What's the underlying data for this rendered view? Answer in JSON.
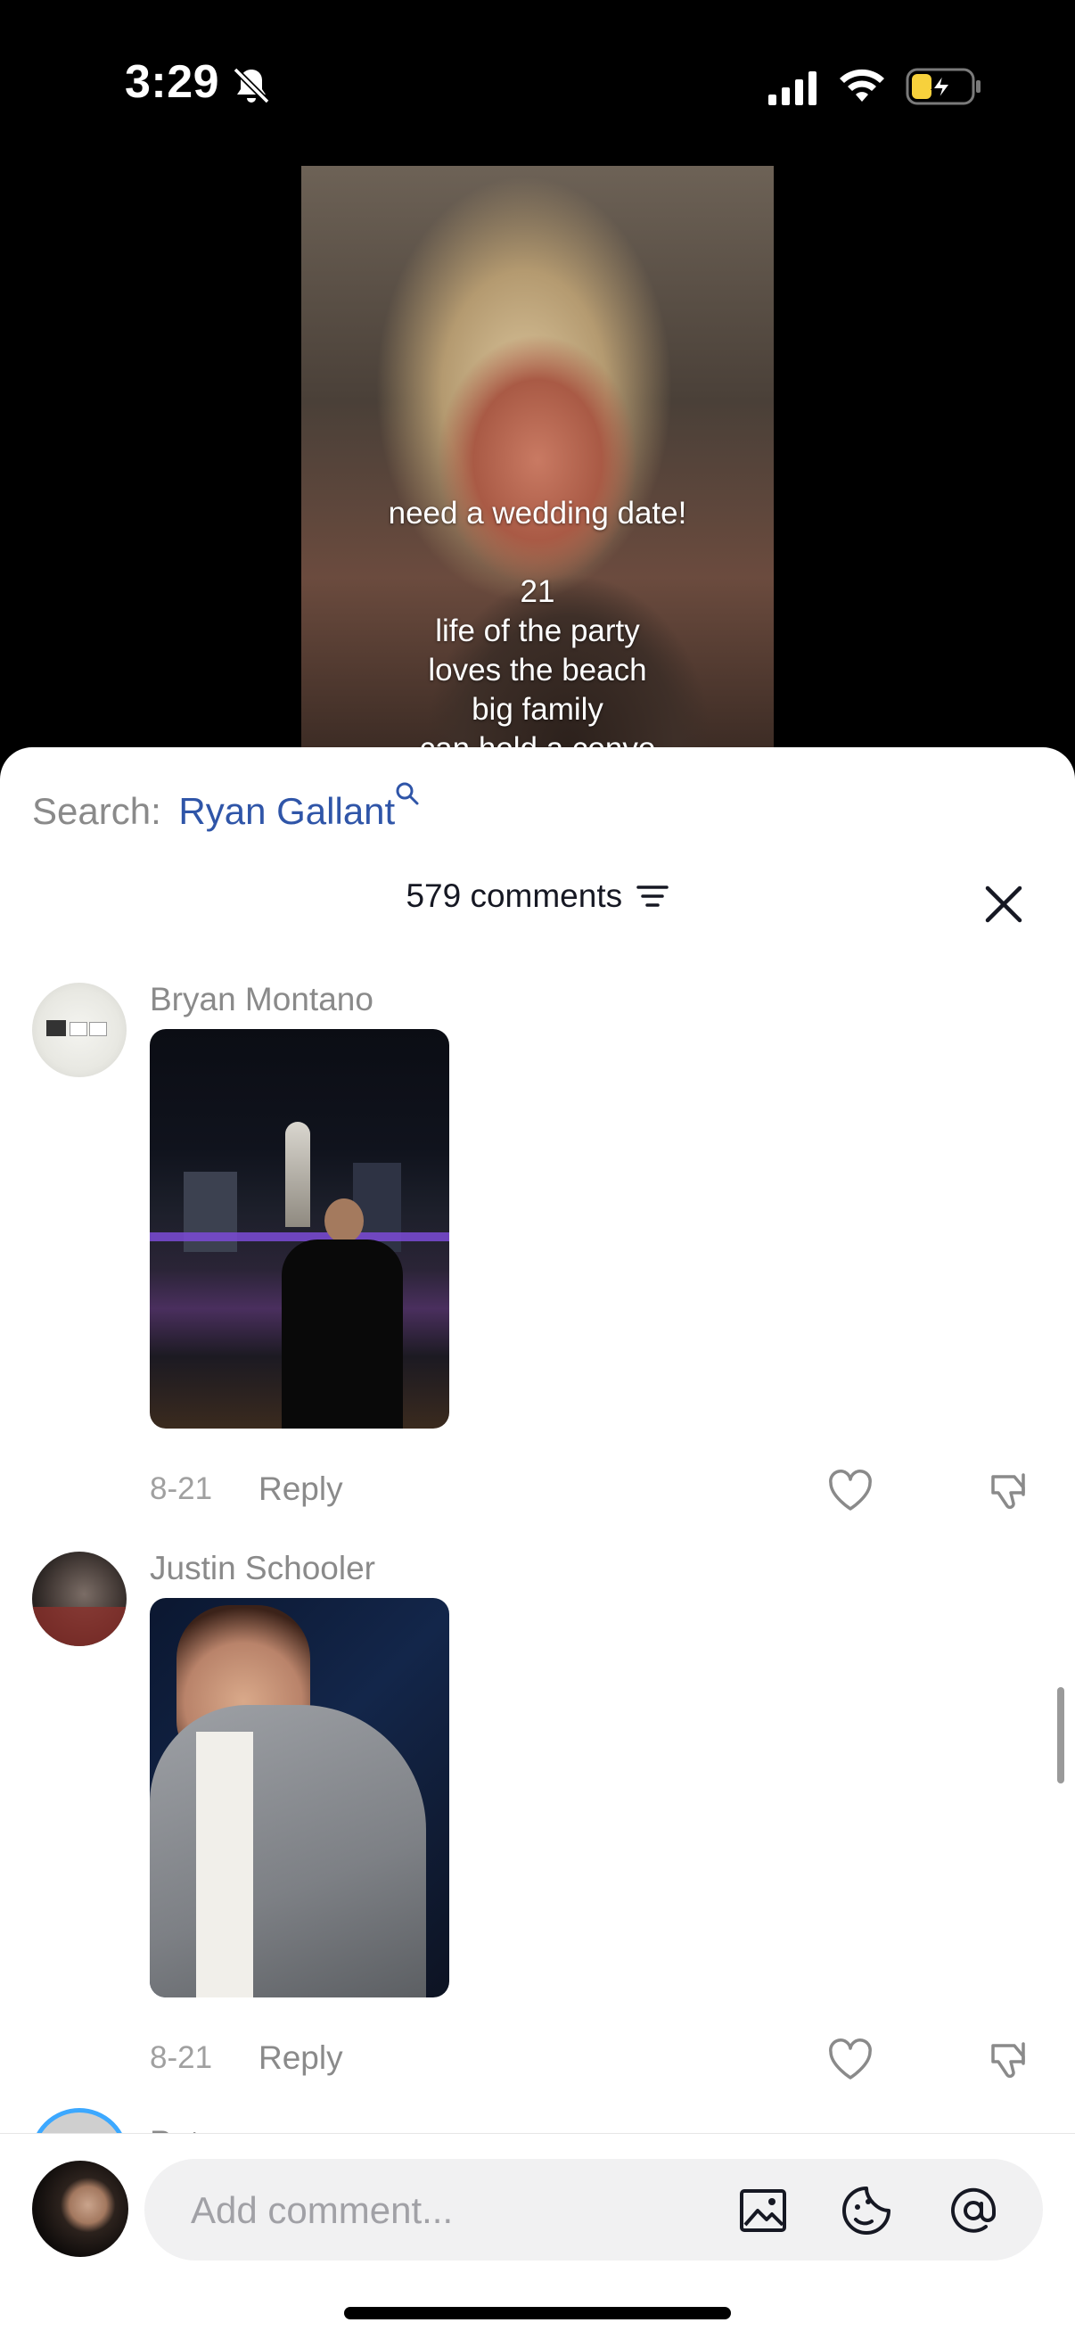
{
  "status_bar": {
    "time": "3:29",
    "icons": [
      "bell-slash-icon",
      "cellular-signal-icon",
      "wifi-icon",
      "battery-charging-icon"
    ]
  },
  "video": {
    "caption_lines": [
      "need a wedding date!",
      "21",
      "life of the party",
      "loves the beach",
      "big family",
      "can hold a convo"
    ]
  },
  "sheet": {
    "search_label": "Search:",
    "search_term": "Ryan Gallant",
    "comments_count": "579 comments",
    "comments": [
      {
        "author": "Bryan Montano",
        "date": "8-21",
        "reply_label": "Reply"
      },
      {
        "author": "Justin Schooler",
        "date": "8-21",
        "reply_label": "Reply"
      }
    ],
    "next_comment_author_partial": "Pet"
  },
  "composer": {
    "placeholder": "Add comment...",
    "icons": [
      "image-icon",
      "sticker-icon",
      "mention-icon"
    ]
  },
  "colors": {
    "accent_link": "#2f55a8",
    "muted_text": "#8a8a8a",
    "input_bg": "#f1f1f2"
  }
}
